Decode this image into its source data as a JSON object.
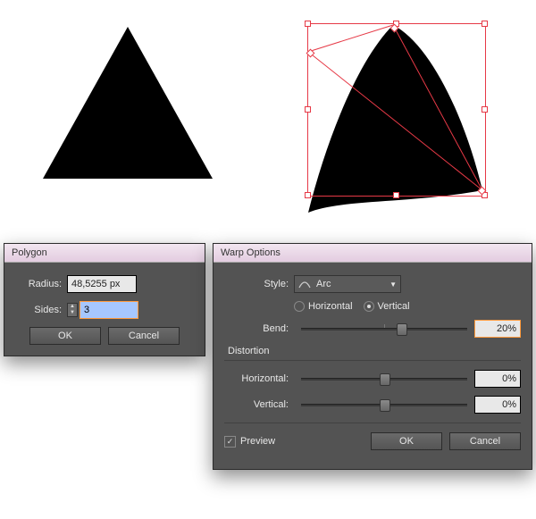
{
  "polygon": {
    "title": "Polygon",
    "radius_label": "Radius:",
    "radius_value": "48,5255 px",
    "sides_label": "Sides:",
    "sides_value": "3",
    "ok": "OK",
    "cancel": "Cancel"
  },
  "warp": {
    "title": "Warp Options",
    "style_label": "Style:",
    "style_value": "Arc",
    "horiz": "Horizontal",
    "vert": "Vertical",
    "bend_label": "Bend:",
    "bend_value": "20%",
    "distortion": "Distortion",
    "dh_label": "Horizontal:",
    "dh_value": "0%",
    "dv_label": "Vertical:",
    "dv_value": "0%",
    "preview": "Preview",
    "ok": "OK",
    "cancel": "Cancel"
  },
  "chart_data": {
    "type": "table",
    "title": "Dialog settings shown",
    "polygon": {
      "radius_px": 48.5255,
      "sides": 3
    },
    "warp": {
      "style": "Arc",
      "orientation": "Vertical",
      "bend_percent": 20,
      "horizontal_distortion_percent": 0,
      "vertical_distortion_percent": 0,
      "preview": true
    }
  }
}
